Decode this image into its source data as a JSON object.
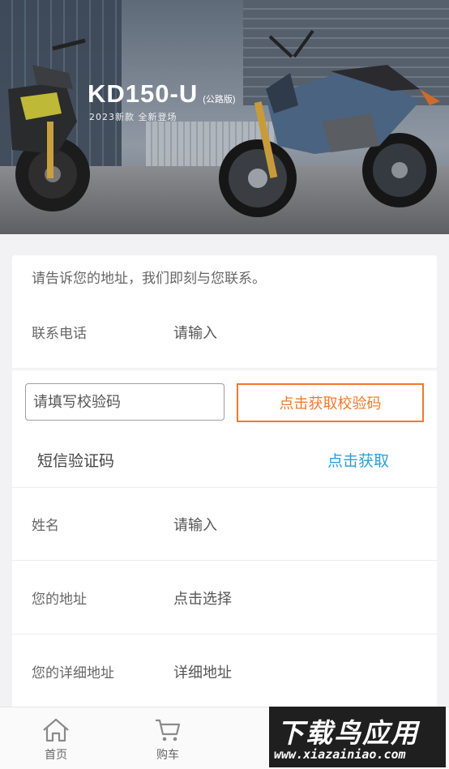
{
  "banner": {
    "model": "KD150-U",
    "variant": "(公路版)",
    "tagline": "2023新款 全新登场"
  },
  "form": {
    "intro": "请告诉您的地址，我们即刻与您联系。",
    "phone": {
      "label": "联系电话",
      "placeholder": "请输入"
    },
    "verify": {
      "placeholder": "请填写校验码",
      "button": "点击获取校验码"
    },
    "sms": {
      "label": "短信验证码",
      "action": "点击获取"
    },
    "name": {
      "label": "姓名",
      "placeholder": "请输入"
    },
    "address": {
      "label": "您的地址",
      "placeholder": "点击选择"
    },
    "detail": {
      "label": "您的详细地址",
      "placeholder": "详细地址"
    }
  },
  "tabbar": {
    "home": {
      "label": "首页",
      "icon": "home-icon"
    },
    "cart": {
      "label": "购车",
      "icon": "cart-icon"
    }
  },
  "watermark": {
    "text": "下载鸟应用",
    "url": "www.xiazainiao.com"
  },
  "colors": {
    "accent": "#f07a2a",
    "link": "#2a9fd8",
    "page_bg": "#f2f2f4"
  }
}
